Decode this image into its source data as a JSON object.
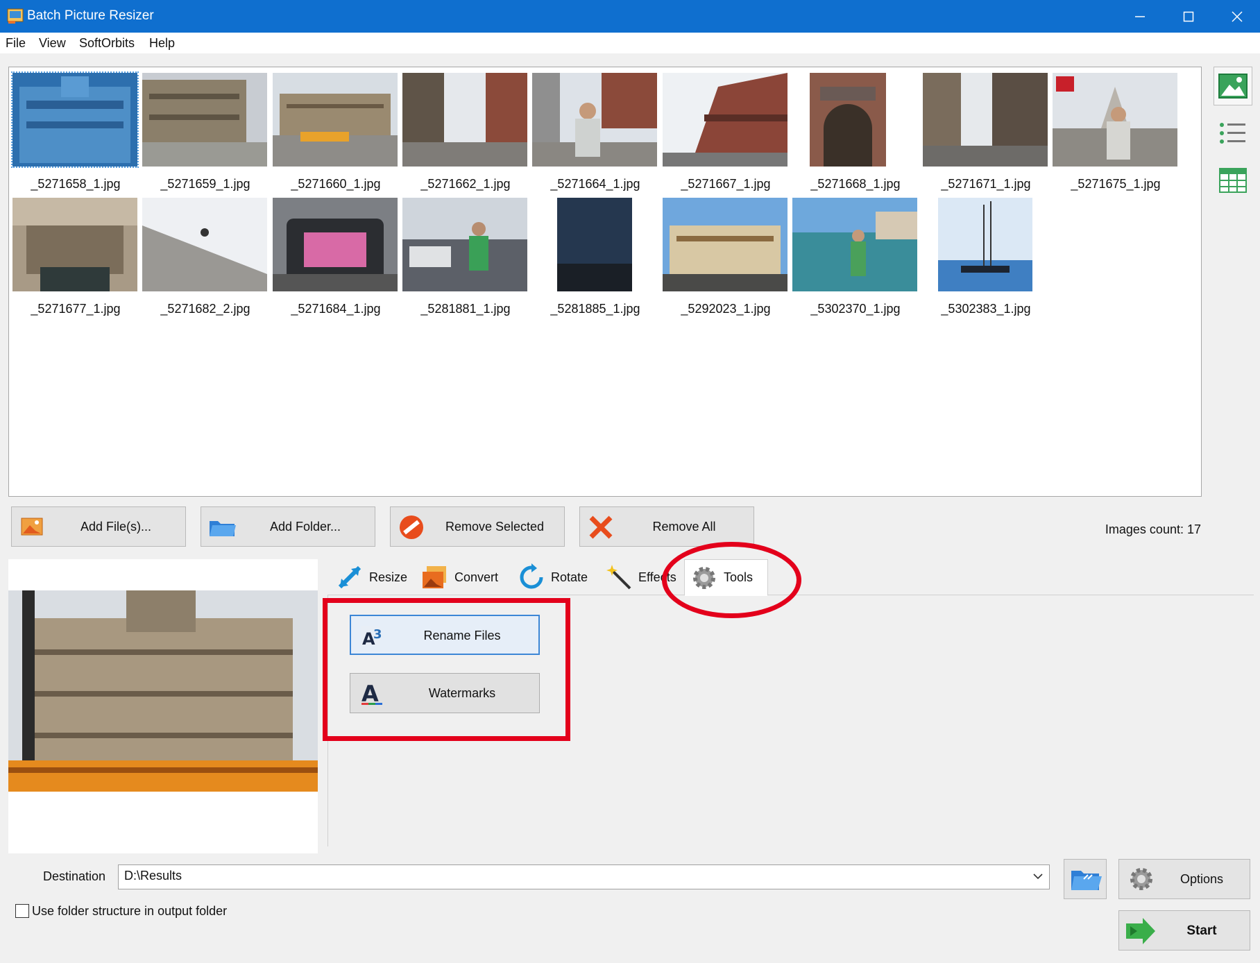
{
  "window": {
    "title": "Batch Picture Resizer"
  },
  "menu": [
    "File",
    "View",
    "SoftOrbits",
    "Help"
  ],
  "gallery": {
    "images": [
      "_5271658_1.jpg",
      "_5271659_1.jpg",
      "_5271660_1.jpg",
      "_5271662_1.jpg",
      "_5271664_1.jpg",
      "_5271667_1.jpg",
      "_5271668_1.jpg",
      "_5271671_1.jpg",
      "_5271675_1.jpg",
      "_5271677_1.jpg",
      "_5271682_2.jpg",
      "_5271684_1.jpg",
      "_5281881_1.jpg",
      "_5281885_1.jpg",
      "_5292023_1.jpg",
      "_5302370_1.jpg",
      "_5302383_1.jpg"
    ]
  },
  "actions": {
    "add_files": "Add File(s)...",
    "add_folder": "Add Folder...",
    "remove_selected": "Remove Selected",
    "remove_all": "Remove All",
    "images_count": "Images count: 17"
  },
  "tabs": [
    "Resize",
    "Convert",
    "Rotate",
    "Effects",
    "Tools"
  ],
  "tools": {
    "rename": "Rename Files",
    "watermarks": "Watermarks"
  },
  "destination": {
    "label": "Destination",
    "value": "D:\\Results"
  },
  "options_label": "Options",
  "start_label": "Start",
  "folder_structure_label": "Use folder structure in output folder",
  "colors": {
    "titlebar": "#0f6fcf",
    "highlight": "#e3001b",
    "focus": "#3c86d6"
  }
}
